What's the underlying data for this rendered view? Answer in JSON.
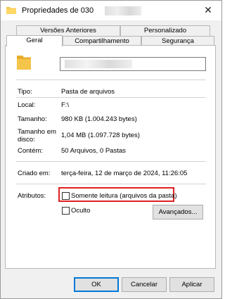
{
  "window": {
    "title": "Propriedades de 030"
  },
  "tabs": {
    "row1": [
      "Versões Anteriores",
      "Personalizado"
    ],
    "row2": [
      "Geral",
      "Compartilhamento",
      "Segurança"
    ]
  },
  "general": {
    "type_label": "Tipo:",
    "type_value": "Pasta de arquivos",
    "location_label": "Local:",
    "location_value": "F:\\",
    "size_label": "Tamanho:",
    "size_value": "980 KB (1.004.243 bytes)",
    "disk_size_label_1": "Tamanho em",
    "disk_size_label_2": "disco:",
    "disk_size_value": "1,04 MB (1.097.728 bytes)",
    "contains_label": "Contém:",
    "contains_value": "50 Arquivos, 0 Pastas",
    "created_label": "Criado em:",
    "created_value": "terça-feira, 12 de março de 2024, 11:26:05",
    "attributes_label": "Atributos:",
    "readonly_label": "Somente leitura (arquivos da pasta)",
    "hidden_label": "Oculto",
    "advanced_button": "Avançados..."
  },
  "buttons": {
    "ok": "OK",
    "cancel": "Cancelar",
    "apply": "Aplicar"
  },
  "colors": {
    "folder": "#f5c44a",
    "highlight": "#e02020",
    "default_button_border": "#0078d7"
  }
}
